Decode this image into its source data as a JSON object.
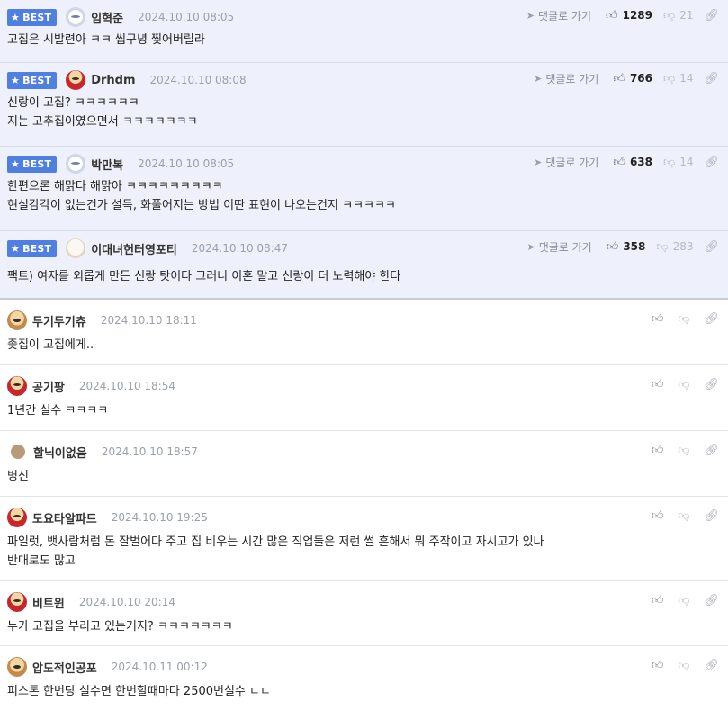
{
  "labels": {
    "best": "BEST",
    "reply_link": "댓글로 가기"
  },
  "best_comments": [
    {
      "nick": "임혁준",
      "date": "2024.10.10 08:05",
      "up": "1289",
      "down": "21",
      "avatar": "bear-avatar",
      "lines": [
        "고집은 시발련아 ㅋㅋ 씹구녕 찢어버릴라"
      ]
    },
    {
      "nick": "Drhdm",
      "date": "2024.10.10 08:08",
      "up": "766",
      "down": "14",
      "avatar": "dog-red-avatar",
      "lines": [
        "신랑이 고집? ㅋㅋㅋㅋㅋㅋ",
        "지는 고추집이였으면서 ㅋㅋㅋㅋㅋㅋㅋ"
      ]
    },
    {
      "nick": "박만복",
      "date": "2024.10.10 08:05",
      "up": "638",
      "down": "14",
      "avatar": "bear-avatar",
      "lines": [
        "한편으론 해맑다 해맑아 ㅋㅋㅋㅋㅋㅋㅋㅋㅋ",
        "현실감각이 없는건가 설득, 화풀어지는 방법 이딴 표현이 나오는건지 ㅋㅋㅋㅋㅋ"
      ]
    },
    {
      "nick": "이대녀헌터영포티",
      "date": "2024.10.10 08:47",
      "up": "358",
      "down": "283",
      "avatar": "white-dog-avatar",
      "lines": [
        "팩트) 여자를 외롭게 만든 신랑 탓이다 그러니 이혼 말고 신랑이 더 노력해야 한다"
      ]
    }
  ],
  "comments": [
    {
      "nick": "두기두기츄",
      "date": "2024.10.10 18:11",
      "avatar": "dog-avatar",
      "lines": [
        "좆집이 고집에게.."
      ]
    },
    {
      "nick": "공기팡",
      "date": "2024.10.10 18:54",
      "avatar": "dog-red-avatar",
      "lines": [
        "1년간 실수 ㅋㅋㅋㅋ"
      ]
    },
    {
      "nick": "할닉이없음",
      "date": "2024.10.10 18:57",
      "avatar": "plain-avatar",
      "lines": [
        "병신"
      ]
    },
    {
      "nick": "도요타알파드",
      "date": "2024.10.10 19:25",
      "avatar": "dog-red-avatar",
      "lines": [
        "파일럿, 뱃사람처럼 돈 잘벌어다 주고 집 비우는 시간 많은 직업들은 저런 썰 흔해서 뭐 주작이고 자시고가 있나",
        "반대로도 많고"
      ]
    },
    {
      "nick": "비트윈",
      "date": "2024.10.10 20:14",
      "avatar": "dog-red-avatar",
      "lines": [
        "누가 고집을 부리고 있는거지? ㅋㅋㅋㅋㅋㅋㅋ"
      ]
    },
    {
      "nick": "압도적인공포",
      "date": "2024.10.11 00:12",
      "avatar": "dog-avatar",
      "lines": [
        "피스톤 한번당 실수면 한번할때마다 2500번실수 ㄷㄷ"
      ]
    }
  ],
  "icons": {
    "up": "thumbs-up-icon",
    "down": "thumbs-down-icon",
    "link": "link-icon",
    "reply": "arrow-icon"
  },
  "colors": {
    "best_badge": "#4f7fe0",
    "best_bg": "#eef1fb"
  }
}
